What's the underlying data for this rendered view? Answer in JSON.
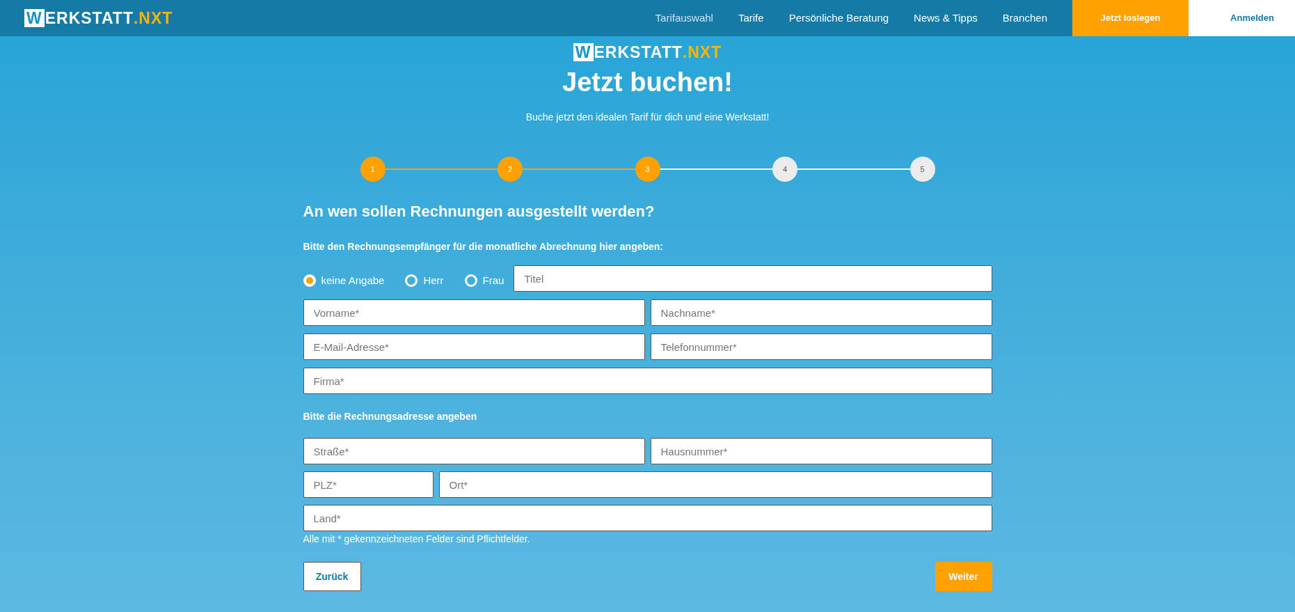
{
  "header": {
    "logo": {
      "initial": "W",
      "word": "ERKSTATT",
      "suffix": ".NXT"
    },
    "nav": [
      {
        "label": "Tarifauswahl",
        "selected": true
      },
      {
        "label": "Tarife",
        "selected": false
      },
      {
        "label": "Persönliche Beratung",
        "selected": false
      },
      {
        "label": "News & Tipps",
        "selected": false
      },
      {
        "label": "Branchen",
        "selected": false
      }
    ],
    "cta": "Jetzt loslegen",
    "login": "Anmelden"
  },
  "hero": {
    "logo": {
      "initial": "W",
      "word": "ERKSTATT",
      "suffix": ".NXT"
    },
    "title": "Jetzt buchen!",
    "subtitle": "Buche jetzt den idealen Tarif für dich und eine Werkstatt!"
  },
  "steps": [
    {
      "label": "1",
      "done": true
    },
    {
      "label": "2",
      "done": true
    },
    {
      "label": "3",
      "done": true
    },
    {
      "label": "4",
      "done": false
    },
    {
      "label": "5",
      "done": false
    }
  ],
  "form": {
    "question": "An wen sollen Rechnungen ausgestellt werden?",
    "recipient_hint": "Bitte den Rechnungsempfänger für die monatliche Abrechnung hier angeben:",
    "salutations": [
      {
        "label": "keine Angabe",
        "selected": true
      },
      {
        "label": "Herr",
        "selected": false
      },
      {
        "label": "Frau",
        "selected": false
      }
    ],
    "title_field": {
      "placeholder": "Titel"
    },
    "recipient_rows": [
      [
        {
          "placeholder": "Vorname*"
        },
        {
          "placeholder": "Nachname*"
        }
      ],
      [
        {
          "placeholder": "E-Mail-Adresse*"
        },
        {
          "placeholder": "Telefonnummer*"
        }
      ],
      [
        {
          "placeholder": "Firma*"
        }
      ]
    ],
    "address_hint": "Bitte die Rechnungsadresse angeben",
    "address_rows": [
      [
        {
          "placeholder": "Straße*"
        },
        {
          "placeholder": "Hausnummer*"
        }
      ],
      [
        {
          "placeholder": "PLZ*",
          "kind": "short"
        },
        {
          "placeholder": "Ort*"
        }
      ],
      [
        {
          "placeholder": "Land*"
        }
      ]
    ],
    "required_note": "Alle mit * gekennzeichneten Felder sind Pflichtfelder.",
    "back": "Zurück",
    "next": "Weiter"
  }
}
